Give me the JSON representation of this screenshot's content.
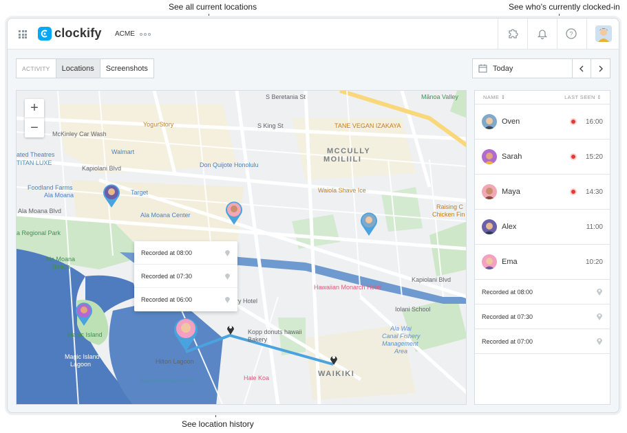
{
  "callouts": {
    "locations": "See all current locations",
    "clocked_in": "See who's currently clocked-in",
    "history": "See location history"
  },
  "header": {
    "app_name": "clockify",
    "workspace": "ACME",
    "icons": [
      "apps-grid-icon",
      "puzzle-icon",
      "bell-icon",
      "help-icon",
      "user-avatar"
    ]
  },
  "tabs": {
    "activity": "ACTIVITY",
    "locations": "Locations",
    "screenshots": "Screenshots"
  },
  "date": {
    "label": "Today"
  },
  "map": {
    "zoom_in": "+",
    "zoom_out": "−",
    "labels": {
      "beretania": "S Beretania St",
      "yogurstory": "YogurStory",
      "king": "S King St",
      "manoa": "Mānoa Valley",
      "mckinley": "McKinley Car Wash",
      "tane": "TANE VEGAN IZAKAYA",
      "theatres": "ated Theatres",
      "titan": "TITAN LUXE",
      "walmart": "Walmart",
      "mccully": "MCCULLY",
      "moiliili": "MOILIILI",
      "kapiolani_top": "Kapiolani Blvd",
      "donquijote": "Don Quijote Honolulu",
      "foodland1": "Foodland Farms",
      "foodland2": "Ala Moana",
      "target": "Target",
      "waiola": "Waiola Shave Ice",
      "raising1": "Raising C",
      "raising2": "Chicken Fin",
      "alamoana_blvd": "Ala Moana Blvd",
      "alamoana_center": "Ala Moana Center",
      "regional": "a Regional Park",
      "alamoana_beach1": "Ala Moana",
      "alamoana_beach2": "Beach",
      "hawaiian": "Hawaiian Monarch Hotel",
      "kapiolani_right": "Kapiolani Blvd",
      "luxury": "ury Hotel",
      "iolani": "Iolani School",
      "alawai1": "Ala Wai",
      "alawai2": "Canal Fishery",
      "alawai3": "Management",
      "alawai4": "Area",
      "magic1": "Magic Island",
      "magic_lagoon1": "Magic Island",
      "magic_lagoon2": "Lagoon",
      "kopp1": "Kopp donuts hawaii",
      "kopp2": "Bakery",
      "hilton": "Hilton Lagoon",
      "kahanamoku": "Kahanamoku Beach",
      "halekoa": "Hale Koa",
      "waikiki": "WAIKIKI"
    },
    "popup": [
      {
        "text": "Recorded at 08:00"
      },
      {
        "text": "Recorded at 07:30"
      },
      {
        "text": "Recorded at 06:00"
      }
    ]
  },
  "panel": {
    "col_name": "NAME",
    "col_last_seen": "LAST SEEN",
    "people": [
      {
        "name": "Oven",
        "time": "16:00",
        "live": true,
        "color": "#7fa8c9"
      },
      {
        "name": "Sarah",
        "time": "15:20",
        "live": true,
        "color": "#b06ad0"
      },
      {
        "name": "Maya",
        "time": "14:30",
        "live": true,
        "color": "#f2a7b5"
      },
      {
        "name": "Alex",
        "time": "11:00",
        "live": false,
        "color": "#6b5fa8"
      },
      {
        "name": "Ema",
        "time": "10:20",
        "live": false,
        "color": "#f4a0c2"
      }
    ],
    "records": [
      {
        "text": "Recorded at 08:00"
      },
      {
        "text": "Recorded at 07:30"
      },
      {
        "text": "Recorded at 07:00"
      }
    ]
  },
  "colors": {
    "brand": "#03a9f4",
    "pin": "#4aa3df",
    "route": "#4aa3df",
    "water": "#4f7bbf",
    "park": "#c9e8c4",
    "live": "#e53935"
  }
}
